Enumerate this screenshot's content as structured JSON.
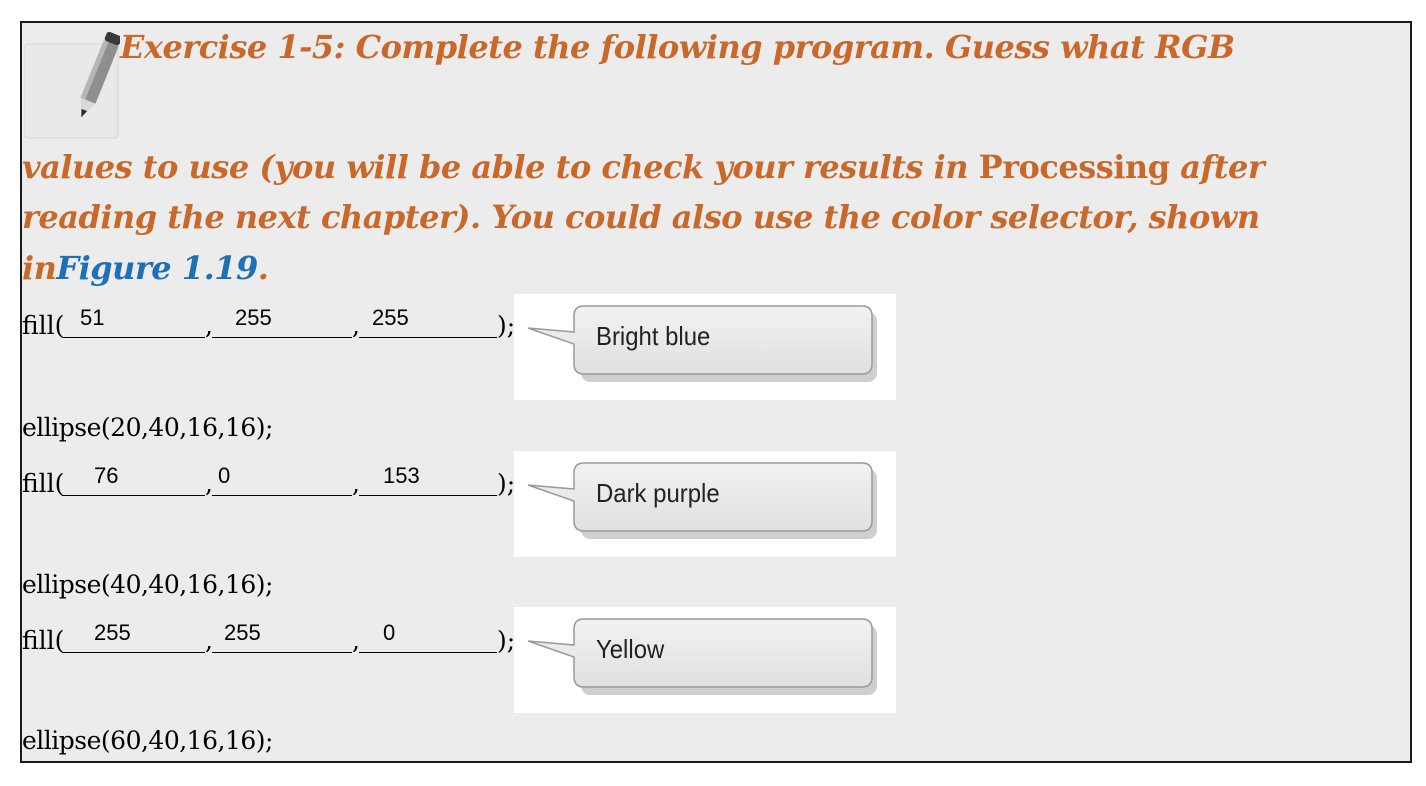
{
  "exercise": {
    "line1": "Exercise 1-5: Complete the following program. Guess what RGB",
    "line2a": "values to use (you will be able to check your results in ",
    "line2b": "Processing",
    "line2c": " after",
    "line3": "reading the next chapter). You could also use the color selector, shown",
    "line4a": "in",
    "line4b": "Figure 1.19",
    "line4c": "."
  },
  "code": {
    "fill_open": "fill(",
    "fill_close": ");",
    "comma": ",",
    "rows": [
      {
        "values": [
          "51",
          "255",
          "255"
        ],
        "callout": "Bright blue",
        "ellipse": "ellipse(20,40,16,16);"
      },
      {
        "values": [
          "76",
          "0",
          "153"
        ],
        "callout": "Dark purple",
        "ellipse": "ellipse(40,40,16,16);"
      },
      {
        "values": [
          "255",
          "255",
          "0"
        ],
        "callout": "Yellow",
        "ellipse": "ellipse(60,40,16,16);"
      }
    ]
  },
  "icons": {
    "pencil": "pencil-icon",
    "callout": "speech-bubble-icon"
  },
  "colors": {
    "heading": "#c8692b",
    "link": "#1f6fb5",
    "background": "#ececec"
  }
}
